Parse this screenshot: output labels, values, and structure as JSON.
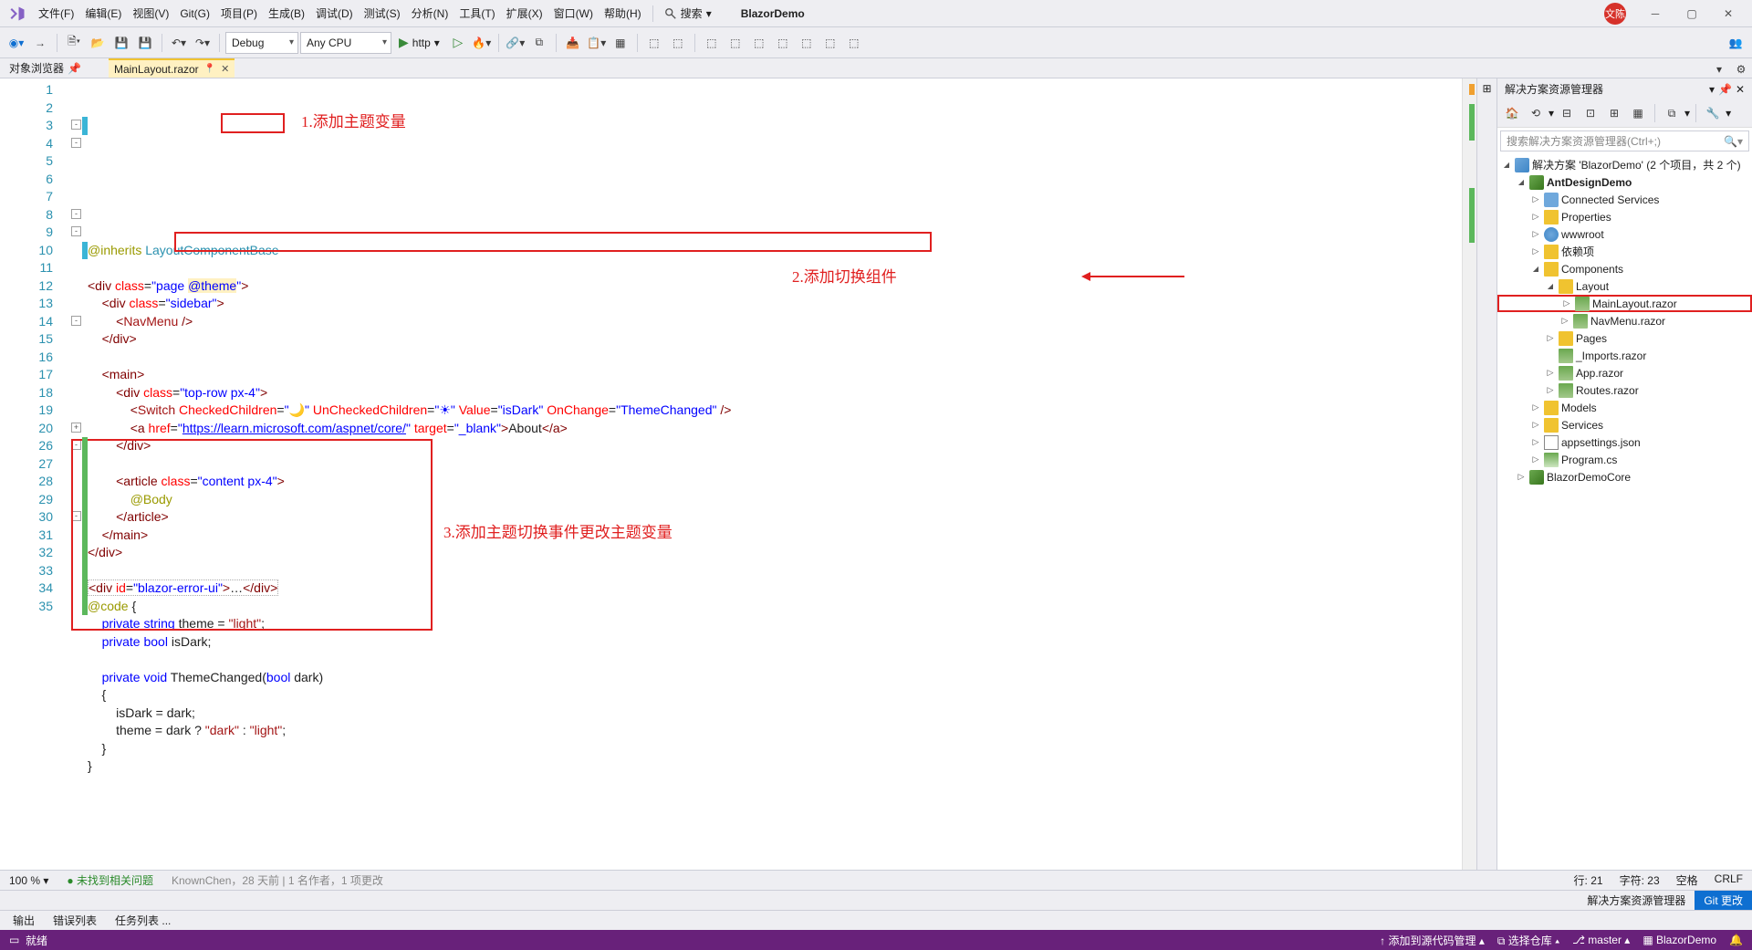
{
  "menu": {
    "file": "文件(F)",
    "edit": "编辑(E)",
    "view": "视图(V)",
    "git": "Git(G)",
    "project": "项目(P)",
    "build": "生成(B)",
    "debug": "调试(D)",
    "test": "测试(S)",
    "analyze": "分析(N)",
    "tools": "工具(T)",
    "extensions": "扩展(X)",
    "window": "窗口(W)",
    "help": "帮助(H)",
    "search": "搜索",
    "app_name": "BlazorDemo"
  },
  "user_badge": "文陈",
  "toolbar": {
    "config": "Debug",
    "platform": "Any CPU",
    "run_target": "http"
  },
  "dock": {
    "object_browser": "对象浏览器",
    "pin": "📌"
  },
  "doc_tab": {
    "name": "MainLayout.razor"
  },
  "annotations": {
    "a1": "1.添加主题变量",
    "a2": "2.添加切换组件",
    "a3": "3.添加主题切换事件更改主题变量"
  },
  "editor": {
    "lines_visible": [
      1,
      2,
      3,
      4,
      5,
      6,
      7,
      8,
      9,
      10,
      11,
      12,
      13,
      14,
      15,
      16,
      17,
      18,
      19,
      20,
      26,
      27,
      28,
      29,
      30,
      31,
      32,
      33,
      34,
      35
    ],
    "lines": {
      "1": {
        "html": "<span class='kw-dir'>@inherits</span> <span class='kw-type'>LayoutComponentBase</span>"
      },
      "2": {
        "html": ""
      },
      "3": {
        "html": "<span class='tag'>&lt;div</span> <span class='attr'>class</span>=<span class='str'>\"page <span style='background:#fff1c2'>@theme</span>\"</span><span class='tag'>&gt;</span>"
      },
      "4": {
        "html": "    <span class='tag'>&lt;div</span> <span class='attr'>class</span>=<span class='str'>\"sidebar\"</span><span class='tag'>&gt;</span>"
      },
      "5": {
        "html": "        <span class='tag'>&lt;</span><span class='elem'>NavMenu</span> <span class='tag'>/&gt;</span>"
      },
      "6": {
        "html": "    <span class='tag'>&lt;/div&gt;</span>"
      },
      "7": {
        "html": ""
      },
      "8": {
        "html": "    <span class='tag'>&lt;main&gt;</span>"
      },
      "9": {
        "html": "        <span class='tag'>&lt;div</span> <span class='attr'>class</span>=<span class='str'>\"top-row px-4\"</span><span class='tag'>&gt;</span>"
      },
      "10": {
        "html": "            <span class='tag'>&lt;</span><span class='elem'>Switch</span> <span class='attr'>CheckedChildren</span>=<span class='str'>\"🌙\"</span> <span class='attr'>UnCheckedChildren</span>=<span class='str'>\"☀\"</span> <span class='attr'>Value</span>=<span class='str'>\"isDark\"</span> <span class='attr'>OnChange</span>=<span class='str'>\"ThemeChanged\"</span> <span class='tag'>/&gt;</span>"
      },
      "11": {
        "html": "            <span class='tag'>&lt;a</span> <span class='attr'>href</span>=<span class='str'>\"<u>https://learn.microsoft.com/aspnet/core/</u>\"</span> <span class='attr'>target</span>=<span class='str'>\"_blank\"</span><span class='tag'>&gt;</span>About<span class='tag'>&lt;/a&gt;</span>"
      },
      "12": {
        "html": "        <span class='tag'>&lt;/div&gt;</span>"
      },
      "13": {
        "html": ""
      },
      "14": {
        "html": "        <span class='tag'>&lt;article</span> <span class='attr'>class</span>=<span class='str'>\"content px-4\"</span><span class='tag'>&gt;</span>"
      },
      "15": {
        "html": "            <span class='kw-dir'>@Body</span>"
      },
      "16": {
        "html": "        <span class='tag'>&lt;/article&gt;</span>"
      },
      "17": {
        "html": "    <span class='tag'>&lt;/main&gt;</span>"
      },
      "18": {
        "html": "<span class='tag'>&lt;/div&gt;</span>"
      },
      "19": {
        "html": ""
      },
      "20": {
        "html": "<span style='border:1px dotted #aaa'><span class='tag'>&lt;div</span> <span class='attr'>id</span>=<span class='str'>\"blazor-error-ui\"</span><span class='tag'>&gt;</span>…<span class='tag'>&lt;/div&gt;</span></span>"
      },
      "26": {
        "html": "<span class='kw-dir'>@code</span> {"
      },
      "27": {
        "html": "    <span class='kw'>private</span> <span class='kw'>string</span> theme = <span class='elem'>\"light\"</span>;"
      },
      "28": {
        "html": "    <span class='kw'>private</span> <span class='kw'>bool</span> isDark;"
      },
      "29": {
        "html": ""
      },
      "30": {
        "html": "    <span class='kw'>private</span> <span class='kw'>void</span> ThemeChanged(<span class='kw'>bool</span> dark)"
      },
      "31": {
        "html": "    {"
      },
      "32": {
        "html": "        isDark = dark;"
      },
      "33": {
        "html": "        theme = dark ? <span class='elem'>\"dark\"</span> : <span class='elem'>\"light\"</span>;"
      },
      "34": {
        "html": "    }"
      },
      "35": {
        "html": "}"
      }
    }
  },
  "editor_status": {
    "zoom": "100 %",
    "issues_icon": "✓",
    "issues": "未找到相关问题",
    "blame": "KnownChen，28 天前 | 1 名作者，1 项更改",
    "row_label": "行:",
    "row": "21",
    "col_label": "字符:",
    "col": "23",
    "ins": "空格",
    "crlf": "CRLF"
  },
  "solution_explorer": {
    "title": "解决方案资源管理器",
    "search_placeholder": "搜索解决方案资源管理器(Ctrl+;)",
    "root": "解决方案 'BlazorDemo' (2 个项目，共 2 个)",
    "nodes": [
      {
        "depth": 0,
        "arrow": "open",
        "icon": "sln",
        "label": "解决方案 'BlazorDemo' (2 个项目，共 2 个)"
      },
      {
        "depth": 1,
        "arrow": "open",
        "icon": "proj",
        "label": "AntDesignDemo",
        "bold": true
      },
      {
        "depth": 2,
        "arrow": "closed",
        "icon": "conn",
        "label": "Connected Services"
      },
      {
        "depth": 2,
        "arrow": "closed",
        "icon": "folder",
        "label": "Properties"
      },
      {
        "depth": 2,
        "arrow": "closed",
        "icon": "globe",
        "label": "wwwroot"
      },
      {
        "depth": 2,
        "arrow": "closed",
        "icon": "folder",
        "label": "依赖项"
      },
      {
        "depth": 2,
        "arrow": "open",
        "icon": "folder",
        "label": "Components"
      },
      {
        "depth": 3,
        "arrow": "open",
        "icon": "folder",
        "label": "Layout"
      },
      {
        "depth": 4,
        "arrow": "closed",
        "icon": "razor",
        "label": "MainLayout.razor",
        "highlight": true
      },
      {
        "depth": 4,
        "arrow": "closed",
        "icon": "razor",
        "label": "NavMenu.razor"
      },
      {
        "depth": 3,
        "arrow": "closed",
        "icon": "folder",
        "label": "Pages"
      },
      {
        "depth": 3,
        "arrow": "none",
        "icon": "razor",
        "label": "_Imports.razor"
      },
      {
        "depth": 3,
        "arrow": "closed",
        "icon": "razor",
        "label": "App.razor"
      },
      {
        "depth": 3,
        "arrow": "closed",
        "icon": "razor",
        "label": "Routes.razor"
      },
      {
        "depth": 2,
        "arrow": "closed",
        "icon": "folder",
        "label": "Models"
      },
      {
        "depth": 2,
        "arrow": "closed",
        "icon": "folder",
        "label": "Services"
      },
      {
        "depth": 2,
        "arrow": "closed",
        "icon": "file",
        "label": "appsettings.json"
      },
      {
        "depth": 2,
        "arrow": "closed",
        "icon": "cs",
        "label": "Program.cs"
      },
      {
        "depth": 1,
        "arrow": "closed",
        "icon": "proj",
        "label": "BlazorDemoCore"
      }
    ]
  },
  "right_tabs": {
    "sol": "解决方案资源管理器",
    "git": "Git 更改"
  },
  "bottom_tabs": {
    "output": "输出",
    "errors": "错误列表",
    "tasks": "任务列表 ..."
  },
  "statusbar": {
    "ready": "就绪",
    "add_src": "↑ 添加到源代码管理 ▴",
    "repo": "⧉ 选择仓库 ▴",
    "branch": "⎇ master ▴",
    "proj": "BlazorDemo",
    "bell": "🔔"
  }
}
